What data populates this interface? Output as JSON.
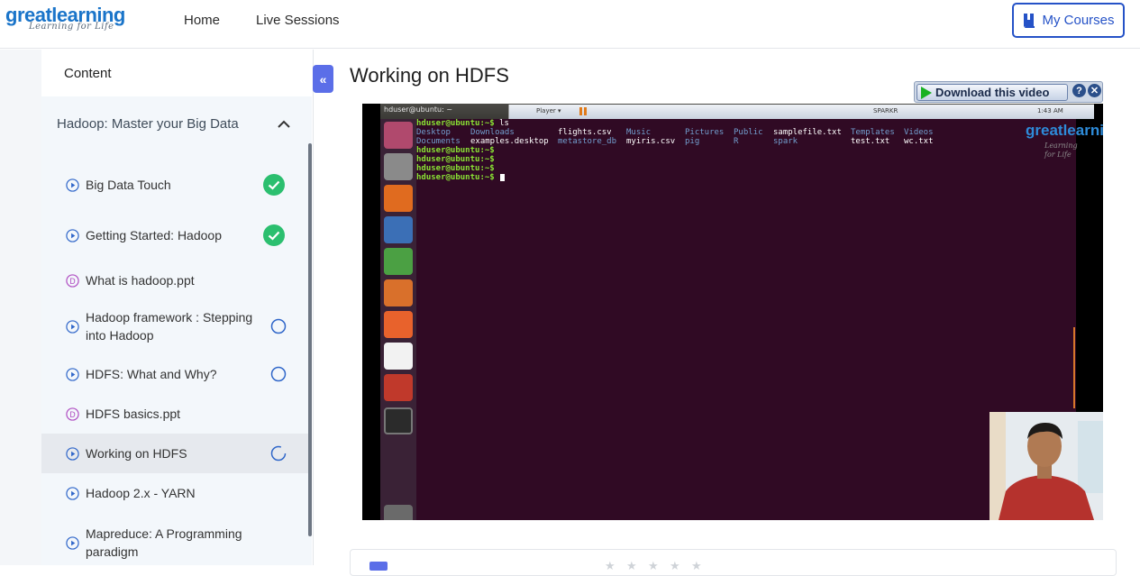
{
  "header": {
    "logo_text": "greatlearning",
    "logo_tagline": "Learning for Life",
    "nav": [
      {
        "label": "Home"
      },
      {
        "label": "Live Sessions"
      }
    ],
    "my_courses_label": "My Courses",
    "accent_color": "#2552c7"
  },
  "sidebar": {
    "heading": "Content",
    "module_title": "Hadoop: Master your Big Data",
    "items": [
      {
        "label": "Big Data Touch",
        "type": "video",
        "status": "completed"
      },
      {
        "label": "Getting Started: Hadoop",
        "type": "video",
        "status": "completed"
      },
      {
        "label": "What is hadoop.ppt",
        "type": "document",
        "status": "none"
      },
      {
        "label": "Hadoop framework : Stepping into Hadoop",
        "type": "video",
        "status": "not-started"
      },
      {
        "label": "HDFS: What and Why?",
        "type": "video",
        "status": "not-started"
      },
      {
        "label": "HDFS basics.ppt",
        "type": "document",
        "status": "none"
      },
      {
        "label": "Working on HDFS",
        "type": "video",
        "status": "in-progress",
        "active": true
      },
      {
        "label": "Hadoop 2.x - YARN",
        "type": "video",
        "status": "none"
      },
      {
        "label": "Mapreduce: A Programming paradigm",
        "type": "video",
        "status": "none"
      }
    ],
    "collapse_icon": "double-chevron-left-icon"
  },
  "main": {
    "title": "Working on HDFS",
    "download_label": "Download this video",
    "help_label": "?",
    "close_label": "✕"
  },
  "video": {
    "window_title": "hduser@ubuntu: ~",
    "player_menu": "Player ▾",
    "vm_name": "SPARKR",
    "clock": "1:43 AM",
    "overlay_logo": "greatlearning",
    "overlay_tagline": "Learning for Life",
    "terminal": {
      "prompt": "hduser@ubuntu:~$",
      "command": " ls",
      "ls_row1": [
        "Desktop",
        "Downloads",
        "flights.csv",
        "Music",
        "Pictures",
        "Public",
        "samplefile.txt",
        "Templates",
        "Videos"
      ],
      "ls_row2": [
        "Documents",
        "examples.desktop",
        "metastore_db",
        "myiris.csv",
        "pig",
        "R",
        "spark",
        "test.txt",
        "wc.txt"
      ]
    }
  }
}
